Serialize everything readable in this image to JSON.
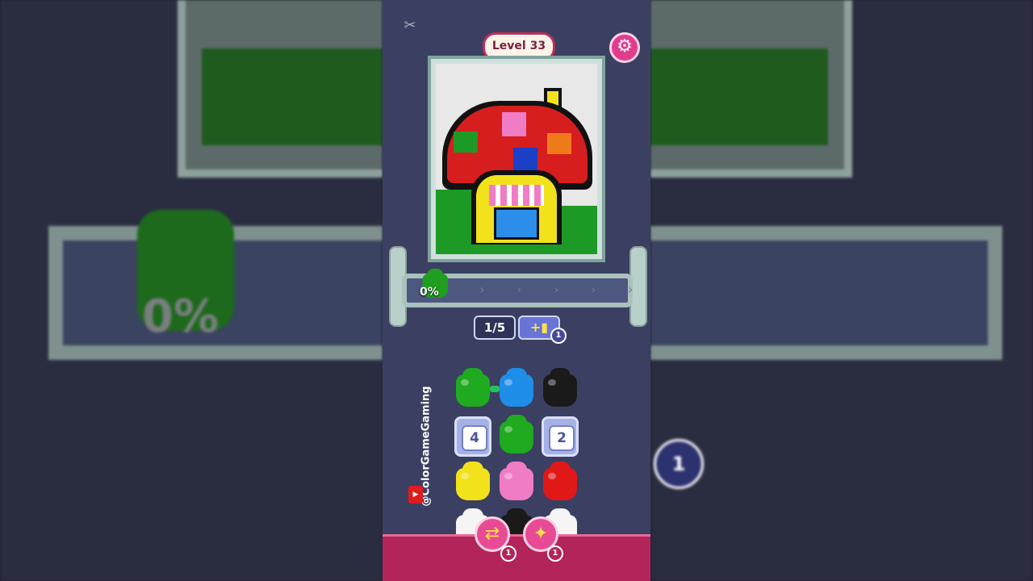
{
  "header": {
    "brand_icon": "capcut-icon",
    "level_label": "Level 33",
    "settings_icon": "gear-icon"
  },
  "tray": {
    "percent": "0%",
    "bucket_color": "#1f9e1f"
  },
  "counters": {
    "slots": "1/5",
    "add_slot_icon": "bucket-plus-icon",
    "add_slot_badge": "1"
  },
  "watermark": {
    "channel": "@ColorGameGaming",
    "icon": "youtube-icon"
  },
  "grid": {
    "row1": [
      {
        "color": "#1faa1f"
      },
      {
        "color": "#1f8ee8"
      },
      {
        "color": "#1a1a1a"
      }
    ],
    "row2": [
      {
        "locked": "4"
      },
      {
        "color": "#1faa1f"
      },
      {
        "locked": "2"
      }
    ],
    "row3": [
      {
        "color": "#f2e21c"
      },
      {
        "color": "#f07cc6"
      },
      {
        "color": "#e01818"
      }
    ],
    "row4_colors": [
      "#f5f5f5",
      "#1a1a1a",
      "#f5f5f5"
    ]
  },
  "powerups": [
    {
      "icon": "shuffle-icon",
      "badge": "1"
    },
    {
      "icon": "magic-wand-icon",
      "badge": "1"
    }
  ],
  "background": {
    "percent": "0%",
    "badge": "1"
  }
}
